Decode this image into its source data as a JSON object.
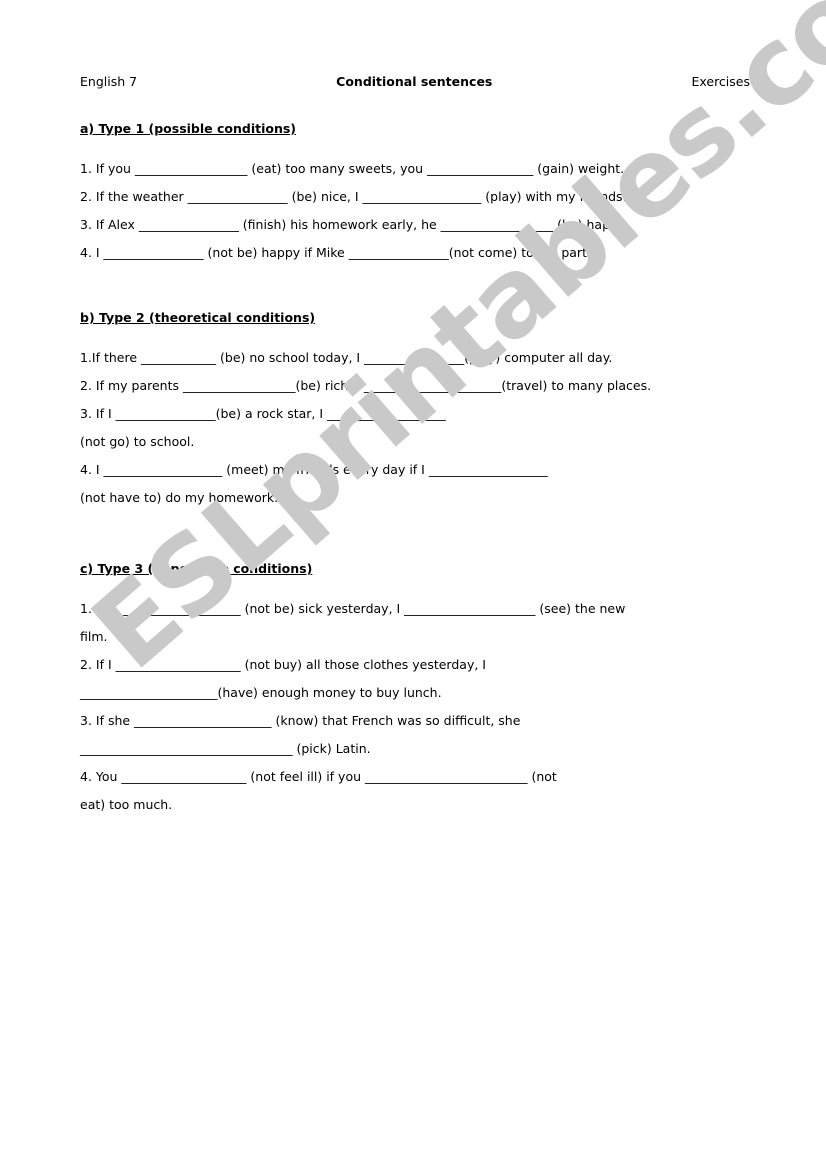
{
  "document": {
    "header": {
      "left": "English 7",
      "center": "Conditional sentences",
      "right": "Exercises"
    },
    "watermark": {
      "text": "ESLprintables.com",
      "color": "#c9c9c9"
    },
    "sections": [
      {
        "id": "type-1",
        "heading": "a) Type 1 (possible conditions)",
        "lines": [
          "1. If you __________________ (eat) too many sweets, you _________________ (gain) weight.",
          "2. If the weather ________________ (be) nice, I ___________________ (play) with my friends.",
          "3. If Alex ________________ (finish) his homework early, he __________________ (be) happy.",
          "4. I ________________ (not be) happy if Mike ________________(not come) to my party."
        ]
      },
      {
        "id": "type-2",
        "heading": "b) Type 2 (theoretical conditions)",
        "lines": [
          "1.If there ____________ (be) no school today, I ________________(play) computer all day.",
          "2. If my parents __________________(be) rich, I ______________________(travel) to many places.",
          "3. If I ________________(be) a rock star, I ___________________",
          "(not go) to school.",
          "4. I ___________________ (meet) my friends every day if I ___________________",
          "(not have to) do my homework."
        ]
      },
      {
        "id": "type-3",
        "heading": "c) Type 3 (impossible conditions)",
        "lines": [
          "1. If I ____________________ (not be) sick yesterday, I _____________________ (see) the new",
          "film.",
          "2. If I ____________________ (not buy) all those clothes yesterday, I",
          "______________________(have) enough money to buy lunch.",
          "3. If she ______________________ (know) that French was so difficult, she",
          "__________________________________ (pick) Latin.",
          "4. You ____________________ (not feel ill) if you __________________________ (not",
          "eat) too much."
        ]
      }
    ]
  }
}
